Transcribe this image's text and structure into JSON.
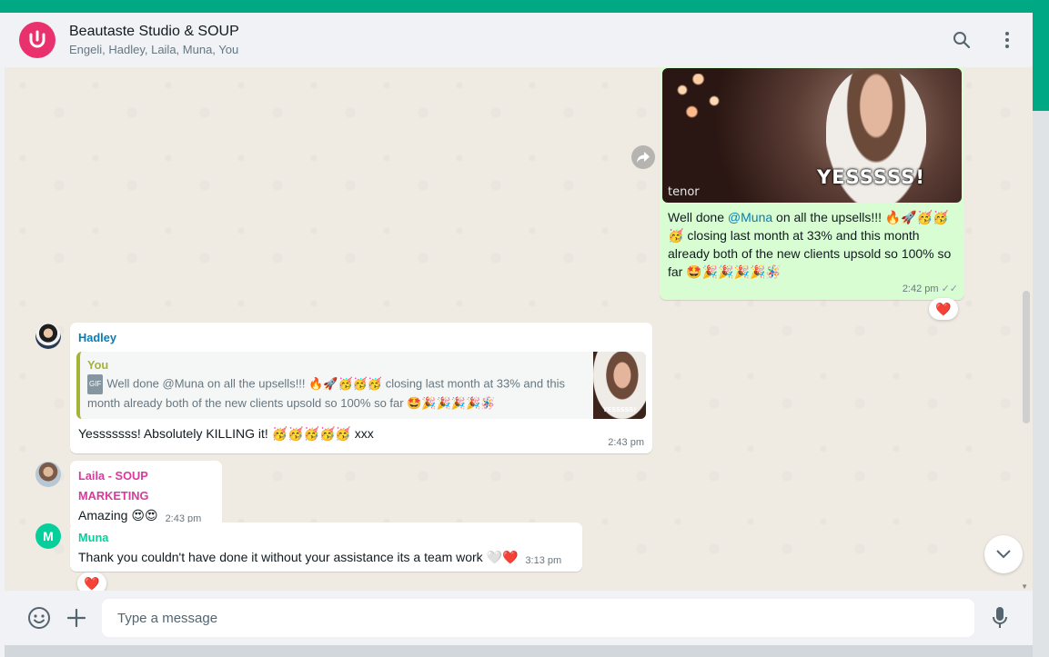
{
  "colors": {
    "accent": "#00a884",
    "outgoing_bubble": "#d9fdd3",
    "mention": "#027eb5"
  },
  "header": {
    "title": "Beautaste Studio & SOUP",
    "members": "Engeli, Hadley, Laila, Muna, You",
    "avatar_icon": "group-logo-icon",
    "search_icon": "search-icon",
    "menu_icon": "kebab-menu-icon"
  },
  "messages": {
    "outgoing": {
      "gif_caption": "YESSSSS!",
      "gif_brand": "tenor",
      "text_pre": "Well done ",
      "mention": "@Muna",
      "text_post": " on all the upsells!!! 🔥🚀🥳🥳🥳 closing last month at 33% and this month already both of the new clients upsold so 100% so far 🤩🎉🎉🎉🎉🪅",
      "time": "2:42 pm",
      "ticks": "✓✓",
      "reaction": "❤️"
    },
    "hadley": {
      "sender": "Hadley",
      "sender_color": "#027eb5",
      "quote_author": "You",
      "quote_gif_label": "GIF",
      "quote_text": "Well done @Muna on all the upsells!!! 🔥🚀🥳🥳🥳 closing last month at 33% and this month already both of the new clients upsold so 100% so far 🤩🎉🎉🎉🎉🪅",
      "quote_thumb_caption": "YESSSSS!",
      "text": "Yesssssss! Absolutely KILLING it! 🥳🥳🥳🥳🥳 xxx",
      "time": "2:43 pm"
    },
    "laila": {
      "sender": "Laila - SOUP MARKETING",
      "sender_color": "#d93a9b",
      "text": "Amazing 😍😍",
      "time": "2:43 pm"
    },
    "muna": {
      "sender": "Muna",
      "sender_color": "#06cf9c",
      "avatar_letter": "M",
      "text": "Thank you couldn't have done it without your assistance its a team work 🤍❤️",
      "time": "3:13 pm",
      "reaction": "❤️"
    }
  },
  "footer": {
    "placeholder": "Type a message",
    "emoji_icon": "emoji-icon",
    "attach_icon": "plus-icon",
    "mic_icon": "microphone-icon"
  }
}
